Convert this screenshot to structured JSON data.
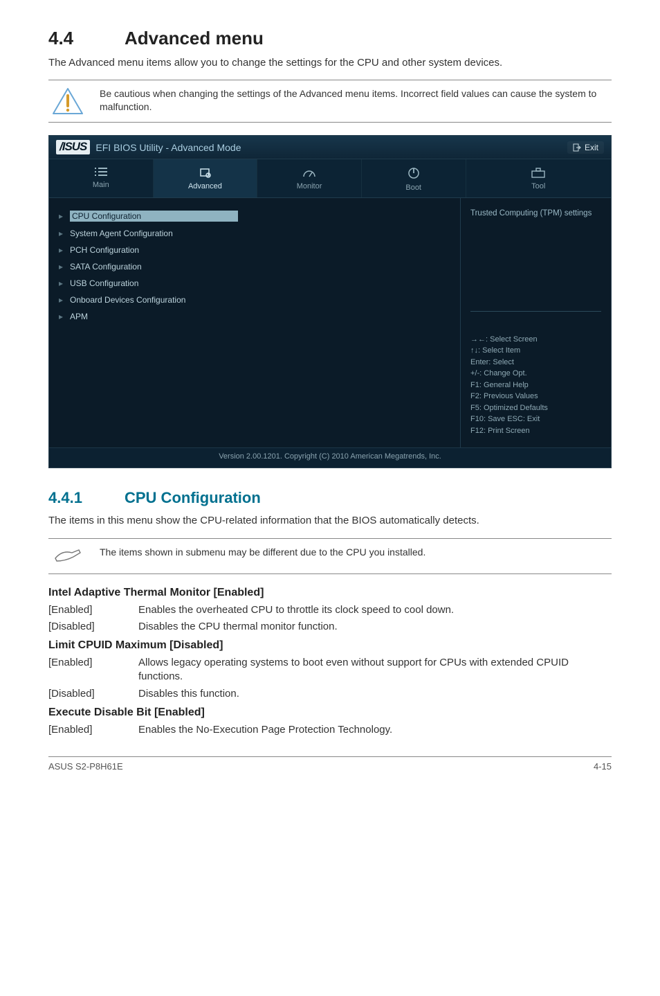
{
  "section": {
    "num": "4.4",
    "title": "Advanced menu"
  },
  "intro": "The Advanced menu items allow you to change the settings for the CPU and other system devices.",
  "caution": "Be cautious when changing the settings of the Advanced menu items. Incorrect field values can cause the system to malfunction.",
  "bios": {
    "title": "EFI BIOS Utility - Advanced Mode",
    "exit": "Exit",
    "tabs": {
      "main": "Main",
      "advanced": "Advanced",
      "monitor": "Monitor",
      "boot": "Boot",
      "tool": "Tool"
    },
    "items": [
      "CPU Configuration",
      "System Agent Configuration",
      "PCH Configuration",
      "SATA Configuration",
      "USB Configuration",
      "Onboard Devices Configuration",
      "APM"
    ],
    "help_top": "Trusted Computing (TPM) settings",
    "help_bottom": "→←:  Select Screen\n↑↓:  Select Item\nEnter:  Select\n+/-:  Change Opt.\nF1:  General Help\nF2:  Previous Values\nF5:  Optimized Defaults\nF10:  Save   ESC:  Exit\nF12: Print Screen",
    "footer": "Version  2.00.1201.   Copyright  (C)  2010  American  Megatrends,  Inc."
  },
  "subsection": {
    "num": "4.4.1",
    "title": "CPU Configuration"
  },
  "sub_intro": "The items in this menu show the CPU-related information that the BIOS automatically detects.",
  "note2": "The items shown in submenu may be different due to the CPU you installed.",
  "params": {
    "thermal": {
      "title": "Intel Adaptive Thermal Monitor [Enabled]",
      "rows": [
        {
          "k": "[Enabled]",
          "v": "Enables the overheated CPU to throttle its clock speed to cool down."
        },
        {
          "k": "[Disabled]",
          "v": "Disables the CPU thermal monitor function."
        }
      ]
    },
    "cpuid": {
      "title": "Limit CPUID Maximum [Disabled]",
      "rows": [
        {
          "k": "[Enabled]",
          "v": "Allows legacy operating systems to boot even without support for CPUs with extended CPUID functions."
        },
        {
          "k": "[Disabled]",
          "v": "Disables this function."
        }
      ]
    },
    "edb": {
      "title": "Execute Disable Bit [Enabled]",
      "rows": [
        {
          "k": "[Enabled]",
          "v": "Enables the No-Execution Page Protection Technology."
        }
      ]
    }
  },
  "footer": {
    "left": "ASUS S2-P8H61E",
    "right": "4-15"
  }
}
